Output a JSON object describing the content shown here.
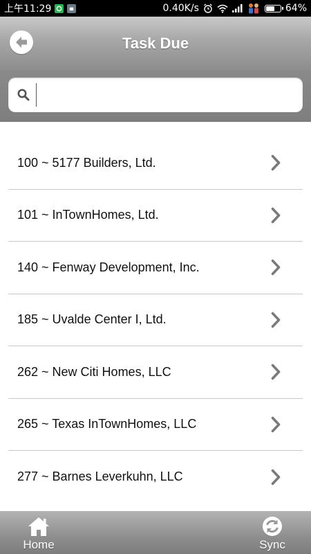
{
  "status_bar": {
    "time": "上午11:29",
    "speed": "0.40K/s",
    "battery": "64%",
    "battery_level": 0.64
  },
  "header": {
    "title": "Task Due",
    "back_icon": "back-arrow-icon"
  },
  "search": {
    "value": "",
    "placeholder": ""
  },
  "list": {
    "items": [
      {
        "label": "100 ~ 5177 Builders, Ltd."
      },
      {
        "label": "101 ~ InTownHomes, Ltd."
      },
      {
        "label": "140 ~ Fenway Development, Inc."
      },
      {
        "label": "185 ~ Uvalde Center I, Ltd."
      },
      {
        "label": "262 ~ New Citi Homes, LLC"
      },
      {
        "label": "265 ~ Texas InTownHomes, LLC"
      },
      {
        "label": "277 ~ Barnes Leverkuhn, LLC"
      }
    ]
  },
  "footer": {
    "home_label": "Home",
    "sync_label": "Sync"
  },
  "colors": {
    "header_gradient_top": "#c9c9c9",
    "header_gradient_bottom": "#8d8d8d",
    "chevron": "#7a7a7a",
    "divider": "#c8c8c8"
  }
}
